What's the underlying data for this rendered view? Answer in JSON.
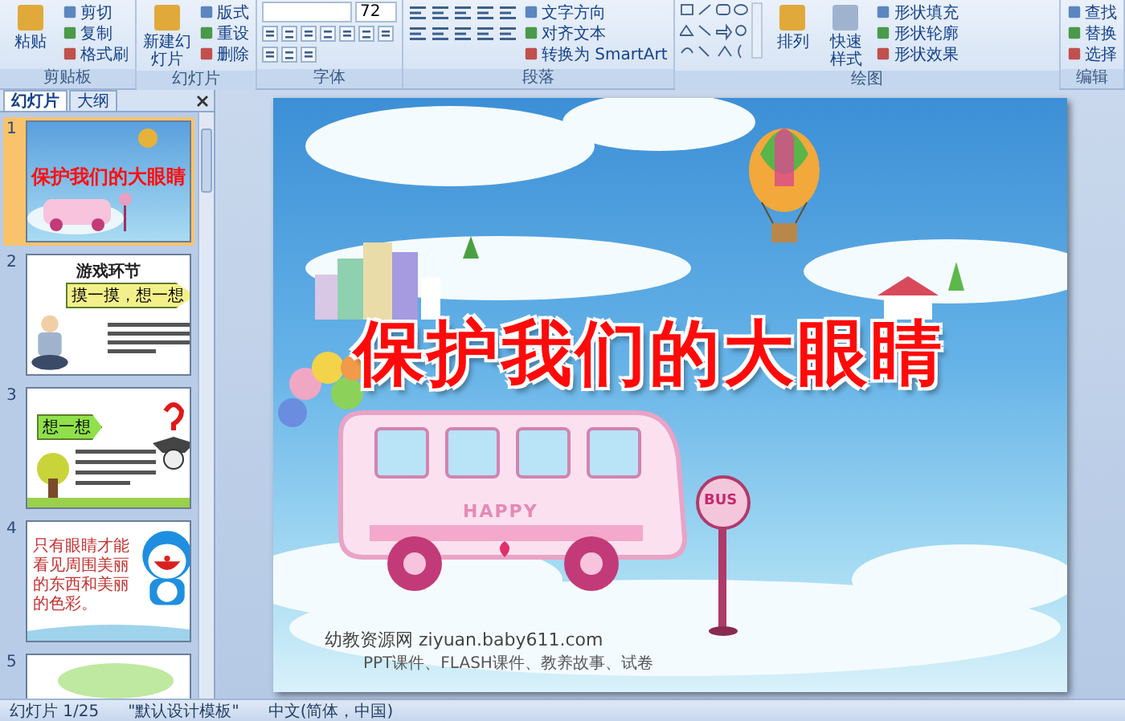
{
  "ribbon": {
    "groups": [
      {
        "kind": "buttons",
        "label": "剪贴板",
        "large": [
          "粘贴"
        ],
        "small": [
          "剪切",
          "复制",
          "格式刷"
        ]
      },
      {
        "kind": "buttons",
        "label": "幻灯片",
        "large": [
          "新建幻灯片"
        ],
        "small": [
          "版式",
          "重设",
          "删除"
        ]
      },
      {
        "kind": "font",
        "label": "字体",
        "size": "72"
      },
      {
        "kind": "paragraph",
        "label": "段落",
        "small": [
          "文字方向",
          "对齐文本",
          "转换为 SmartArt"
        ]
      },
      {
        "kind": "drawing",
        "label": "绘图",
        "large": [
          "排列",
          "快速样式"
        ],
        "small": [
          "形状填充",
          "形状轮廓",
          "形状效果"
        ]
      },
      {
        "kind": "buttons",
        "label": "编辑",
        "small": [
          "查找",
          "替换",
          "选择"
        ]
      }
    ]
  },
  "panel": {
    "tabs": [
      {
        "label": "幻灯片",
        "selected": true
      },
      {
        "label": "大纲",
        "selected": false
      }
    ],
    "thumbnails": [
      {
        "kind": "title",
        "number": "1",
        "selected": true,
        "title": "保护我们的大眼睛"
      },
      {
        "kind": "game",
        "number": "2",
        "selected": false,
        "title": "游戏环节",
        "arrow": "摸一摸，想一想"
      },
      {
        "kind": "think",
        "number": "3",
        "selected": false,
        "arrow": "想一想"
      },
      {
        "kind": "doraemon",
        "number": "4",
        "selected": false,
        "text": "只有眼睛才能看见周围美丽的东西和美丽的色彩。"
      },
      {
        "kind": "bubble",
        "number": "5",
        "selected": false
      }
    ]
  },
  "slide": {
    "title": "保护我们的大眼睛",
    "bus_label": "HAPPY",
    "sign_label": "BUS",
    "site": "幼教资源网 ziyuan.baby611.com",
    "site_sub": "PPT课件、FLASH课件、教养故事、试卷"
  },
  "status_bar": [
    "幻灯片 1/25",
    "\"默认设计模板\"",
    "中文(简体，中国)"
  ]
}
